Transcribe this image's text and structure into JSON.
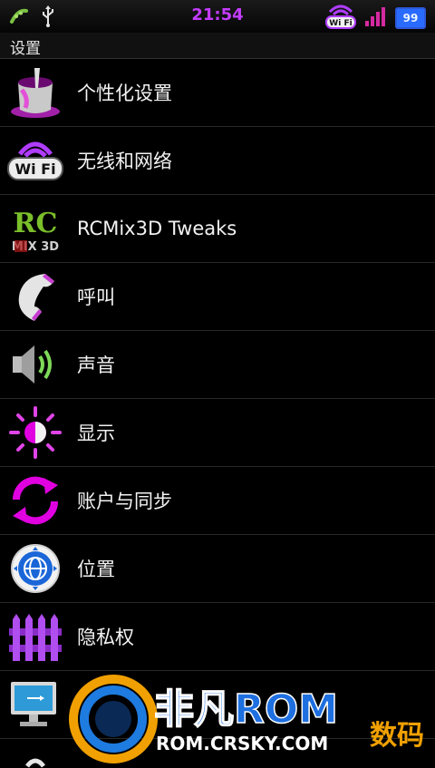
{
  "status_bar": {
    "time": "21:54",
    "battery": "99"
  },
  "title": "设置",
  "items": [
    {
      "label": "个性化设置",
      "icon": "paint-bucket-icon"
    },
    {
      "label": "无线和网络",
      "icon": "wifi-icon"
    },
    {
      "label": "RCMix3D Tweaks",
      "icon": "rcmix3d-logo-icon"
    },
    {
      "label": "呼叫",
      "icon": "phone-handset-icon"
    },
    {
      "label": "声音",
      "icon": "speaker-icon"
    },
    {
      "label": "显示",
      "icon": "brightness-icon"
    },
    {
      "label": "账户与同步",
      "icon": "sync-icon"
    },
    {
      "label": "位置",
      "icon": "globe-location-icon"
    },
    {
      "label": "隐私权",
      "icon": "fence-icon"
    },
    {
      "label": "",
      "icon": "monitor-usb-icon"
    }
  ],
  "watermark": {
    "brand": "非凡ROM",
    "url": "ROM.CRSKY.COM",
    "extra": "数码"
  },
  "colors": {
    "accent": "#c43cff",
    "battery": "#2a6bff"
  }
}
